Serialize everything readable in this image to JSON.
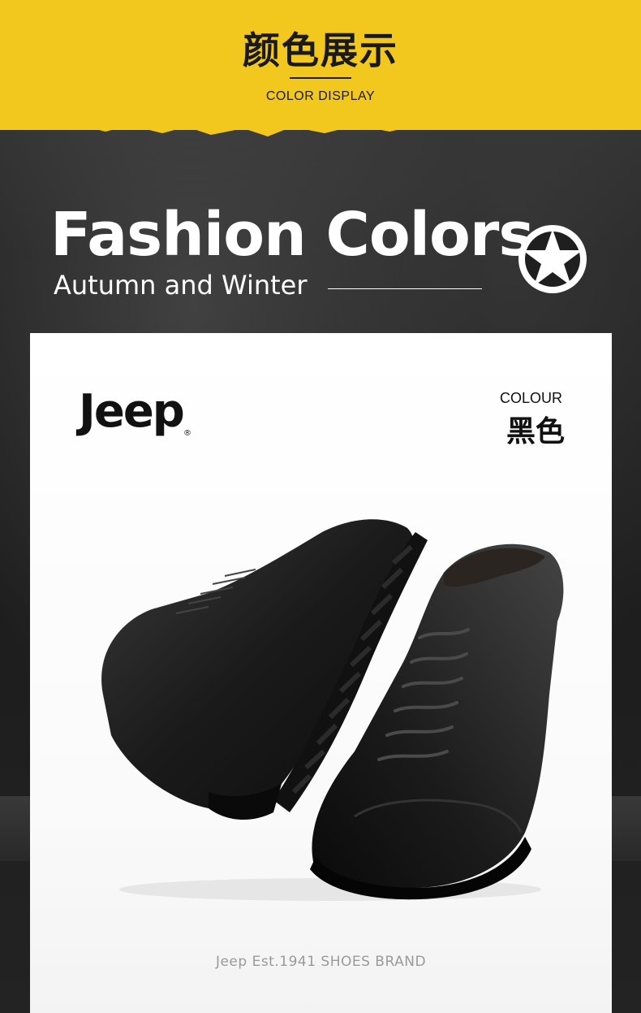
{
  "header": {
    "title": "颜色展示",
    "subtitle": "COLOR DISPLAY",
    "background_color": "#f2c81e"
  },
  "banner": {
    "headline": "Fashion Colors",
    "subheadline": "Autumn and Winter",
    "badge_icon": "star-circle-icon"
  },
  "card": {
    "brand": "Jeep",
    "brand_mark": "®",
    "colour_label": "COLOUR",
    "colour_value": "黑色",
    "product_image": "black-leather-boots",
    "tagline": "Jeep Est.1941 SHOES BRAND"
  }
}
